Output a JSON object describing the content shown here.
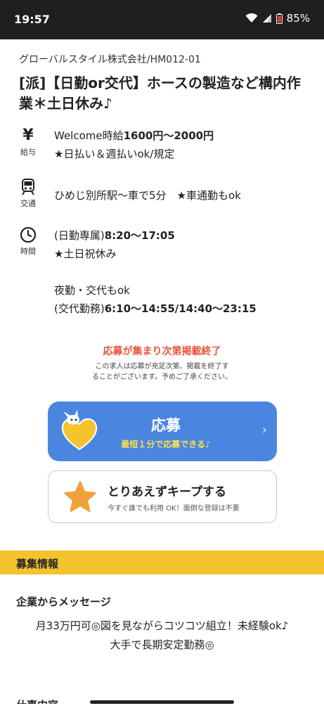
{
  "status_bar": {
    "time": "19:57",
    "battery": "85%"
  },
  "job": {
    "company": "グローバルスタイル株式会社/HM012-01",
    "title": "[派]【日勤or交代】ホースの製造など構内作業＊土日休み♪"
  },
  "salary": {
    "caption": "給与",
    "line1_prefix": "Welcome時給",
    "line1_bold": "1600円〜2000円",
    "line2": "★日払い＆週払いok/規定"
  },
  "transport": {
    "caption": "交通",
    "line1": "ひめじ別所駅〜車で5分　★車通勤もok"
  },
  "hours": {
    "caption": "時間",
    "line1_prefix": "(日勤専属)",
    "line1_bold": "8:20〜17:05",
    "line2": "★土日祝休み",
    "line3": "夜勤・交代もok",
    "line4_prefix": "(交代勤務)",
    "line4_bold": "6:10〜14:55/14:40〜23:15"
  },
  "notice": {
    "headline": "応募が集まり次第掲載終了",
    "line1": "この求人は応募が充足次第、掲載を終了す",
    "line2": "ることがございます。予めご了承ください。"
  },
  "apply": {
    "label": "応募",
    "sub": "最短１分で応募できる♪"
  },
  "keep": {
    "label": "とりあえずキープする",
    "sub": "今すぐ誰でも利用 OK！面倒な登録は不要"
  },
  "recruit_section": {
    "label": "募集情報"
  },
  "message": {
    "heading": "企業からメッセージ",
    "line1": "月33万円可◎図を見ながらコツコツ組立！未経験ok♪",
    "line2": "大手で長期安定勤務◎"
  },
  "next_section": {
    "heading": "仕事内容"
  },
  "colors": {
    "accent_blue": "#4a86e0",
    "accent_yellow": "#f5c32e",
    "notice_red": "#e8553c",
    "star_orange": "#f0a23a"
  }
}
